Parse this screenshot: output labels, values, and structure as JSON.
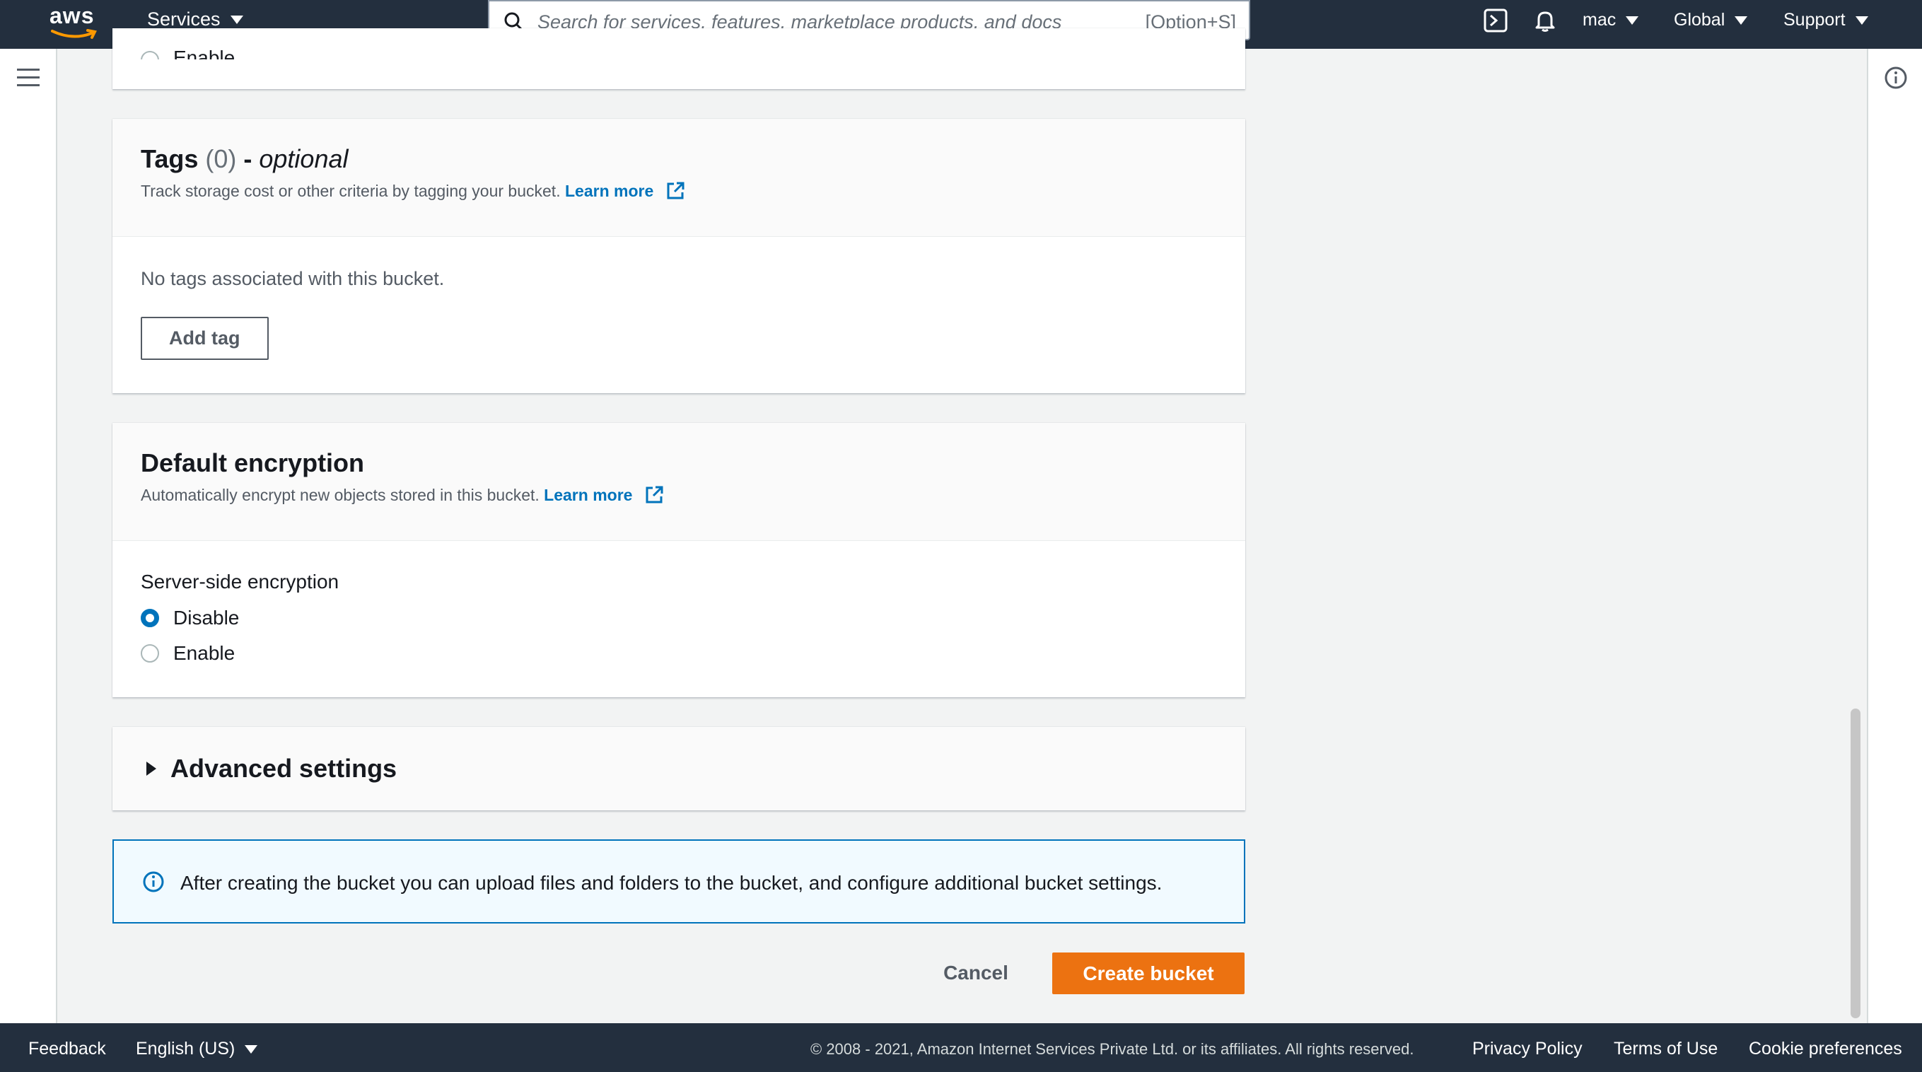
{
  "topnav": {
    "logo_text": "aws",
    "services_label": "Services",
    "search_placeholder": "Search for services, features, marketplace products, and docs",
    "search_shortcut": "[Option+S]",
    "user_label": "mac",
    "region_label": "Global",
    "support_label": "Support"
  },
  "top_cut_text": "Enable",
  "tags_panel": {
    "title": "Tags",
    "count": "(0)",
    "dash": " - ",
    "optional": "optional",
    "description": "Track storage cost or other criteria by tagging your bucket.",
    "learn_more": "Learn more",
    "empty_text": "No tags associated with this bucket.",
    "add_button": "Add tag"
  },
  "encryption_panel": {
    "title": "Default encryption",
    "description": "Automatically encrypt new objects stored in this bucket.",
    "learn_more": "Learn more",
    "field_label": "Server-side encryption",
    "options": [
      {
        "label": "Disable",
        "selected": true
      },
      {
        "label": "Enable",
        "selected": false
      }
    ]
  },
  "advanced_panel": {
    "title": "Advanced settings"
  },
  "info_alert": {
    "text": "After creating the bucket you can upload files and folders to the bucket, and configure additional bucket settings."
  },
  "actions": {
    "cancel": "Cancel",
    "create": "Create bucket"
  },
  "footer": {
    "feedback": "Feedback",
    "language": "English (US)",
    "copyright": "© 2008 - 2021, Amazon Internet Services Private Ltd. or its affiliates. All rights reserved.",
    "privacy": "Privacy Policy",
    "terms": "Terms of Use",
    "cookies": "Cookie preferences"
  },
  "colors": {
    "nav_bg": "#232f3e",
    "link": "#0073bb",
    "primary_button": "#ec7211",
    "info_bg": "#f1faff"
  }
}
